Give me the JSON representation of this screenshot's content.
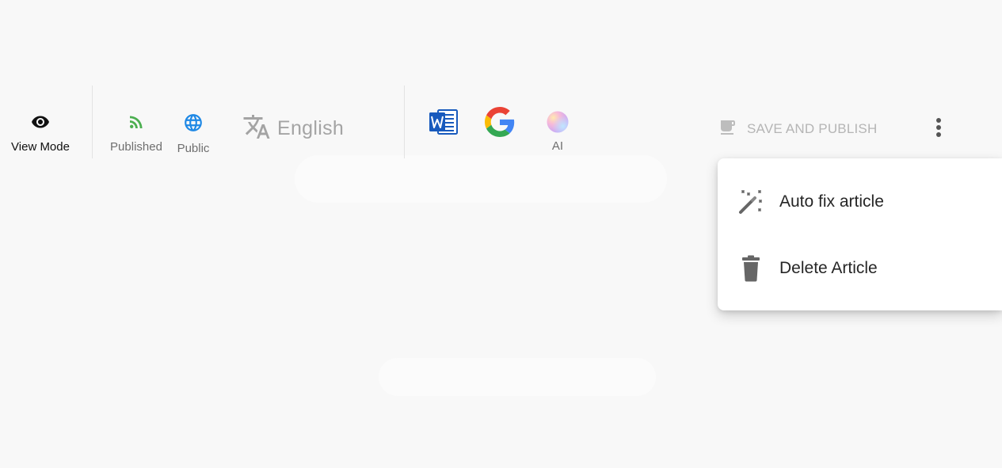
{
  "toolbar": {
    "view_mode": {
      "label": "View Mode",
      "icon": "eye-icon"
    },
    "published": {
      "label": "Published",
      "icon": "rss-feed-icon",
      "color": "#4caf50"
    },
    "public": {
      "label": "Public",
      "icon": "globe-icon",
      "color": "#1e88e5"
    },
    "language": {
      "label": "English",
      "icon": "translate-icon"
    },
    "word": {
      "icon": "word-icon",
      "color": "#185abd"
    },
    "google": {
      "icon": "google-icon"
    },
    "ai": {
      "label": "AI",
      "icon": "ai-orb-icon"
    },
    "save": {
      "label": "SAVE AND PUBLISH",
      "icon": "save-publish-icon"
    },
    "more": {
      "icon": "more-vertical-icon"
    }
  },
  "menu": {
    "items": [
      {
        "label": "Auto fix article",
        "icon": "magic-wand-icon"
      },
      {
        "label": "Delete Article",
        "icon": "trash-icon"
      }
    ]
  }
}
